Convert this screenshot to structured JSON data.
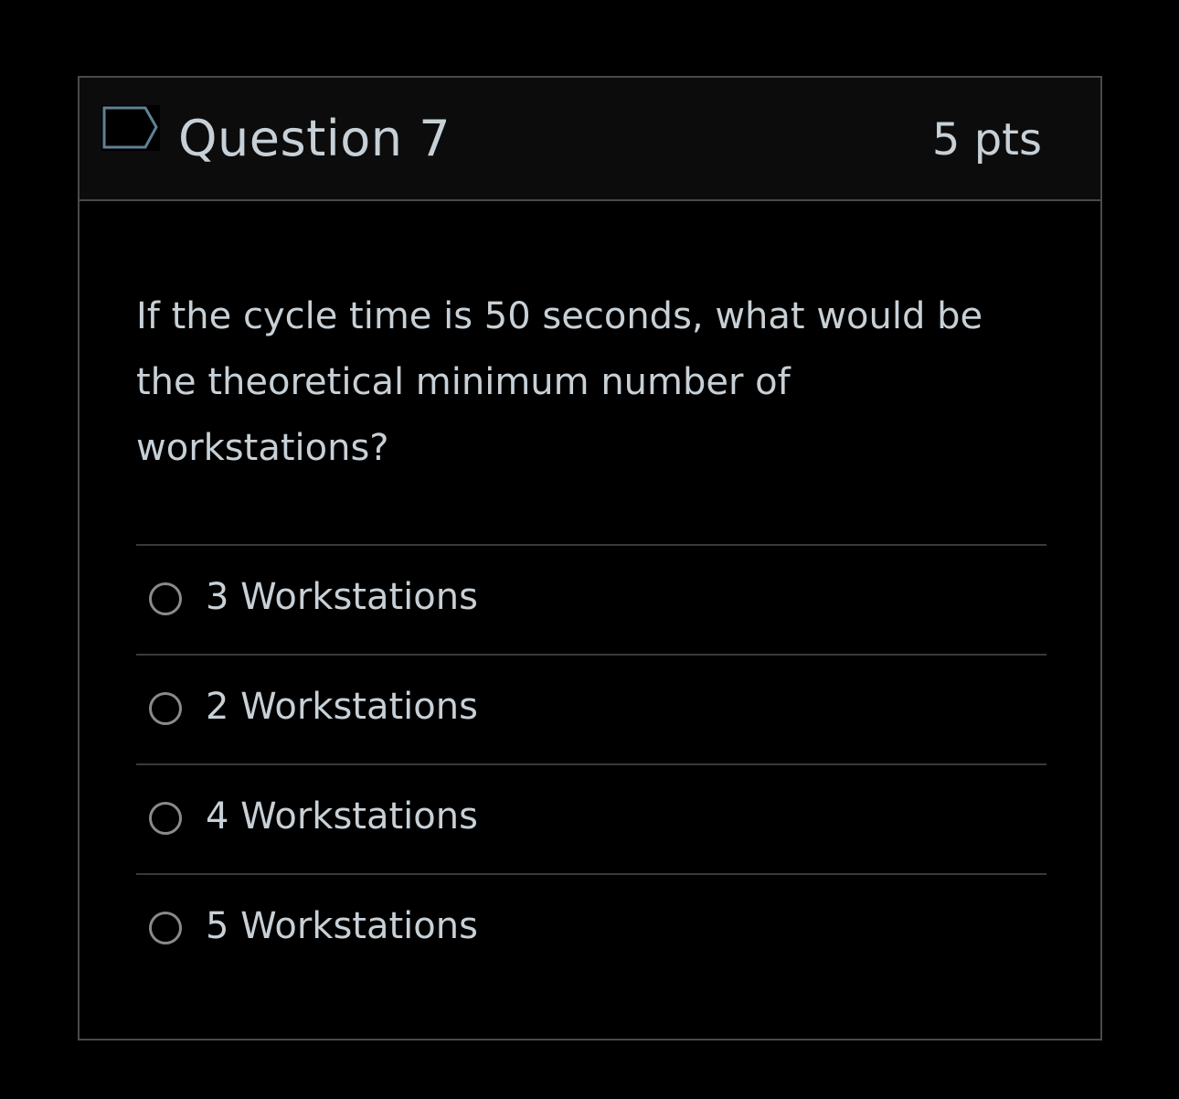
{
  "question": {
    "title": "Question 7",
    "points": "5 pts",
    "text": "If the cycle time is 50 seconds, what would be the theoretical minimum number of workstations?",
    "flag_icon": "flag-icon",
    "colors": {
      "background": "#000000",
      "header_background": "#0c0c0c",
      "text": "#c7d0d6",
      "border": "#4a4a4a",
      "flag_outline": "#5f8194"
    }
  },
  "answers": [
    {
      "label": "3 Workstations",
      "selected": false
    },
    {
      "label": "2 Workstations",
      "selected": false
    },
    {
      "label": "4 Workstations",
      "selected": false
    },
    {
      "label": "5 Workstations",
      "selected": false
    }
  ]
}
